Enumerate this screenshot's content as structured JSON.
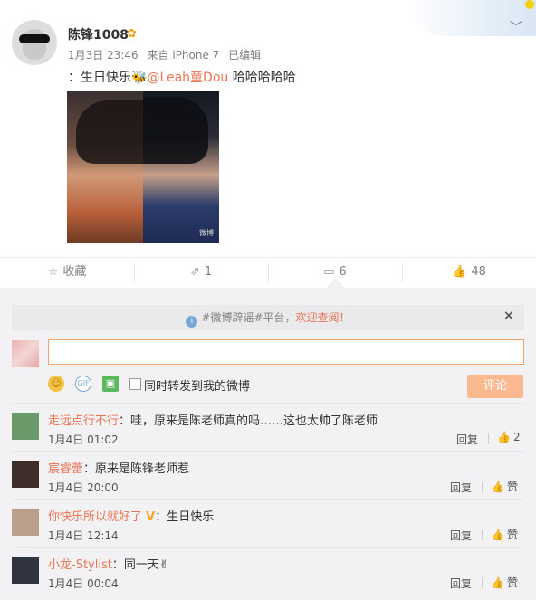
{
  "post": {
    "username": "陈锋1008",
    "vip_badge": "✿",
    "date": "1月3日 23:46",
    "source": "来自 iPhone 7",
    "edited": "已编辑",
    "text_prefix": "：生日快乐",
    "emoji": "🐝",
    "mention": "@Leah童Dou",
    "text_suffix": " 哈哈哈哈哈",
    "photo_watermark": "微博"
  },
  "actions": {
    "favorite": "收藏",
    "repost": "1",
    "comment": "6",
    "like": "48"
  },
  "comment_panel": {
    "notice_text": "#微博辟谣#平台，",
    "notice_link": "欢迎查阅！",
    "input_value": "",
    "forward_label": "同时转发到我的微博",
    "submit_label": "评论",
    "reply_label": "回复"
  },
  "comments": [
    {
      "user": "走远点行不行",
      "text": "：哇，原来是陈老师真的吗……这也太帅了陈老师",
      "time": "1月4日 01:02",
      "like": "2",
      "avatar_color": "#6a9a6a"
    },
    {
      "user": "宸睿蕾",
      "text": "：原来是陈锋老师惹",
      "time": "1月4日 20:00",
      "like": "赞",
      "avatar_color": "#3d2e2a"
    },
    {
      "user": "你快乐所以就好了",
      "badge": "V",
      "text": "：生日快乐",
      "time": "1月4日 12:14",
      "like": "赞",
      "avatar_color": "#b9a08c"
    },
    {
      "user": "小龙-Stylist",
      "text": "：同一天✌",
      "time": "1月4日 00:04",
      "like": "赞",
      "avatar_color": "#2f3440"
    }
  ]
}
